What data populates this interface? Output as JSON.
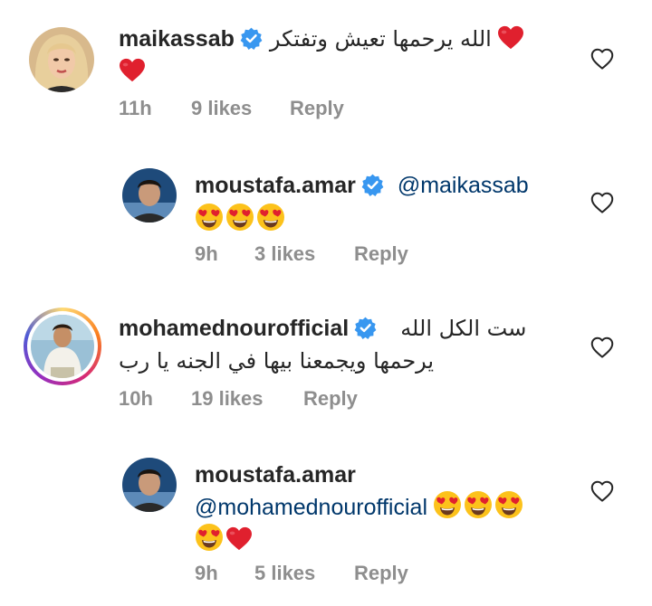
{
  "comments": [
    {
      "username": "maikassab",
      "verified": true,
      "text": "الله يرحمها تعيش وتفتكر",
      "time": "11h",
      "likes": "9 likes",
      "reply": "Reply"
    },
    {
      "username": "moustafa.amar",
      "verified": true,
      "mention": "@maikassab",
      "time": "9h",
      "likes": "3 likes",
      "reply": "Reply"
    },
    {
      "username": "mohamednourofficial",
      "verified": true,
      "text_line1": "ست الكل الله",
      "text_line2": "يرحمها ويجمعنا بيها في الجنه يا رب",
      "time": "10h",
      "likes": "19 likes",
      "reply": "Reply"
    },
    {
      "username": "moustafa.amar",
      "verified": false,
      "mention": "@mohamednourofficial",
      "time": "9h",
      "likes": "5 likes",
      "reply": "Reply"
    }
  ],
  "icons": {
    "verified": "verified-badge-icon",
    "heart_emoji": "red-heart-emoji",
    "heart_eyes_emoji": "smiling-face-with-heart-eyes-emoji",
    "like": "heart-outline-icon"
  },
  "colors": {
    "verified": "#3897f0",
    "mention": "#00376b",
    "meta": "#8e8e8e",
    "heart": "#e0202e"
  }
}
